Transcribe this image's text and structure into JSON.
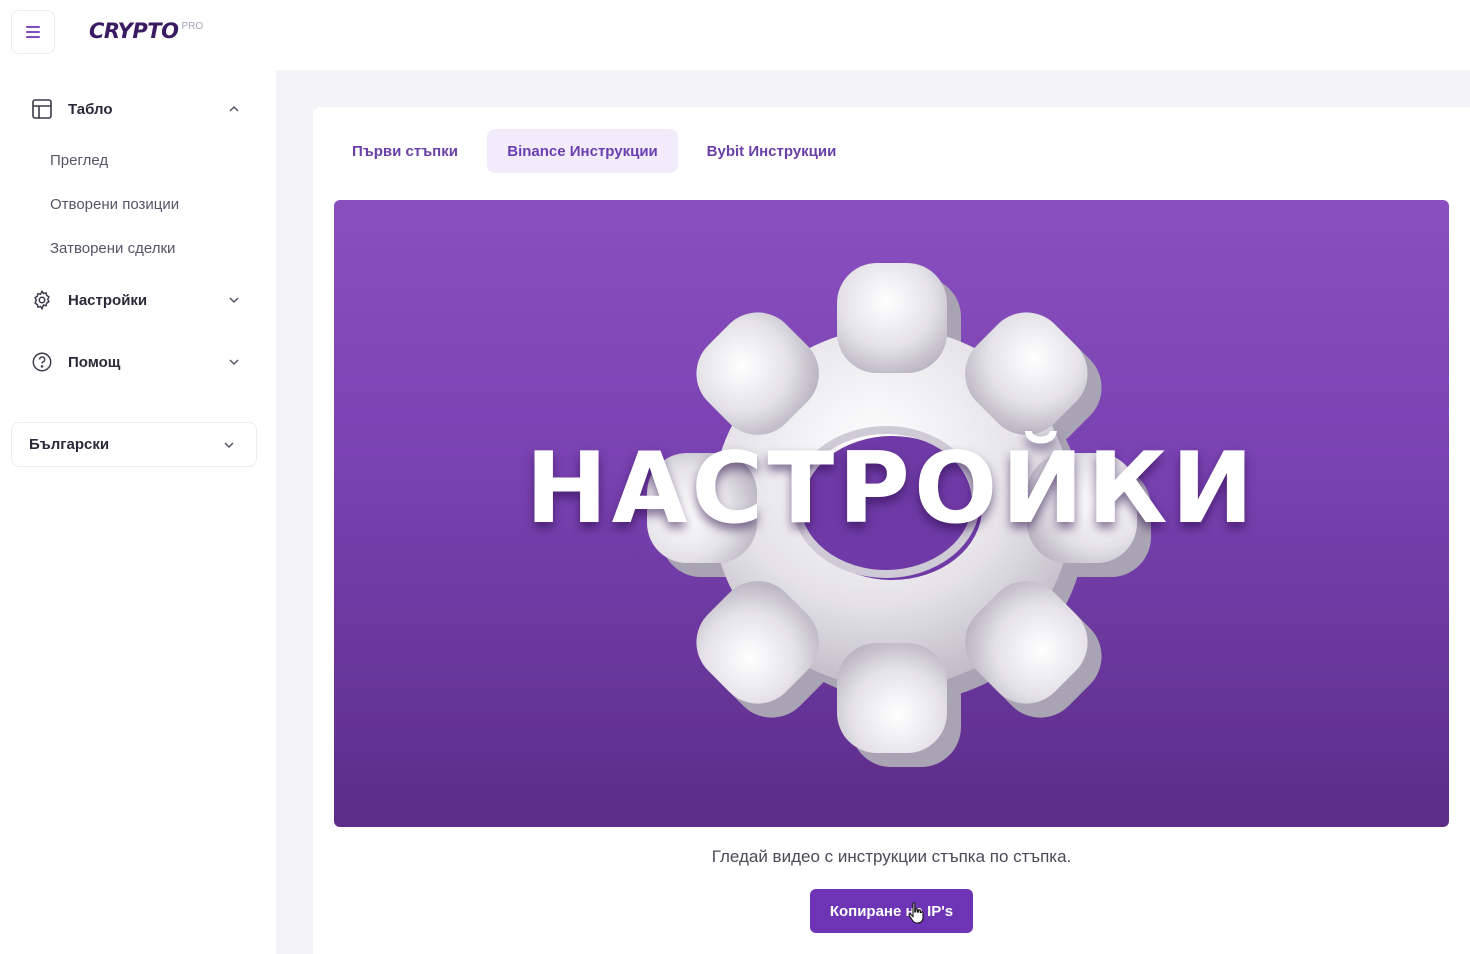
{
  "header": {
    "menu_icon": "hamburger-menu-icon",
    "logo_text": "CRYPTO",
    "logo_sup": "PRO"
  },
  "sidebar": {
    "dashboard": {
      "label": "Табло",
      "icon": "layout-icon",
      "expanded": true,
      "items": [
        {
          "label": "Преглед"
        },
        {
          "label": "Отворени позиции"
        },
        {
          "label": "Затворени сделки"
        }
      ]
    },
    "settings": {
      "label": "Настройки",
      "icon": "gear-icon",
      "expanded": false
    },
    "help": {
      "label": "Помощ",
      "icon": "help-circle-icon",
      "expanded": false
    },
    "language": {
      "value": "Български"
    }
  },
  "tabs": [
    {
      "label": "Първи стъпки",
      "active": false
    },
    {
      "label": "Binance Инструкции",
      "active": true
    },
    {
      "label": "Bybit Инструкции",
      "active": false
    }
  ],
  "video": {
    "title_text": "НАСТРОЙКИ",
    "background_top": "#8a4fbf",
    "background_bottom": "#5c2c88"
  },
  "caption": "Гледай видео с инструкции стъпка по стъпка.",
  "copy_button": {
    "label": "Копиране на IP's"
  },
  "colors": {
    "accent": "#6d35b5",
    "tab_active_bg": "#f1ebfa",
    "logo": "#3a1a60"
  }
}
